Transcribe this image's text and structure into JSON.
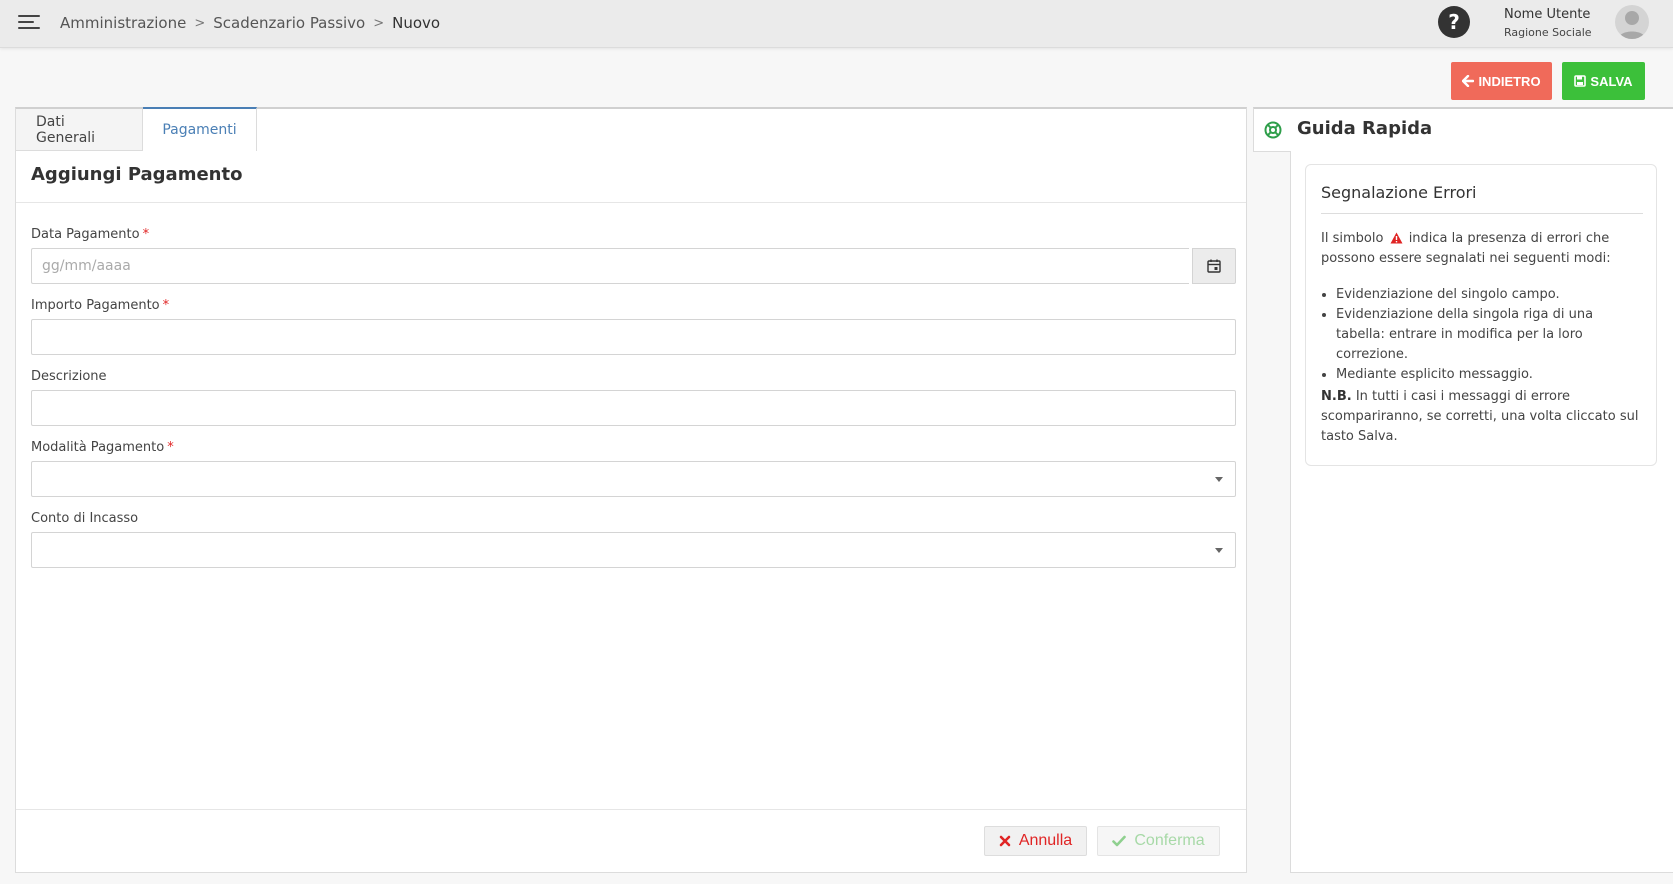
{
  "header": {
    "breadcrumb": [
      "Amministrazione",
      "Scadenzario Passivo",
      "Nuovo"
    ],
    "user_name": "Nome Utente",
    "user_company": "Ragione Sociale",
    "help_label": "?"
  },
  "actions": {
    "back_label": "INDIETRO",
    "save_label": "SALVA",
    "back_color": "#f06a5a",
    "save_color": "#3cc03a"
  },
  "tabs": [
    {
      "label": "Dati Generali",
      "active": false
    },
    {
      "label": "Pagamenti",
      "active": true
    }
  ],
  "form": {
    "title": "Aggiungi Pagamento",
    "fields": {
      "data_pagamento": {
        "label": "Data Pagamento",
        "required": "*",
        "value": "",
        "placeholder": "gg/mm/aaaa"
      },
      "importo_pagamento": {
        "label": "Importo Pagamento",
        "required": "*",
        "value": ""
      },
      "descrizione": {
        "label": "Descrizione",
        "value": ""
      },
      "modalita_pagamento": {
        "label": "Modalità Pagamento",
        "required": "*",
        "selected": ""
      },
      "conto_incasso": {
        "label": "Conto di Incasso",
        "selected": ""
      }
    },
    "cancel_label": "Annulla",
    "confirm_label": "Conferma"
  },
  "guide": {
    "title": "Guida Rapida",
    "card": {
      "title": "Segnalazione Errori",
      "intro_before": "Il simbolo",
      "intro_after": "indica la presenza di errori che possono essere segnalati nei seguenti modi:",
      "items": [
        "Evidenziazione del singolo campo.",
        "Evidenziazione della singola riga di una tabella: entrare in modifica per la loro correzione.",
        "Mediante esplicito messaggio."
      ],
      "note_label": "N.B.",
      "note_text": "In tutti i casi i messaggi di errore scompariranno, se corretti, una volta cliccato sul tasto Salva."
    }
  }
}
